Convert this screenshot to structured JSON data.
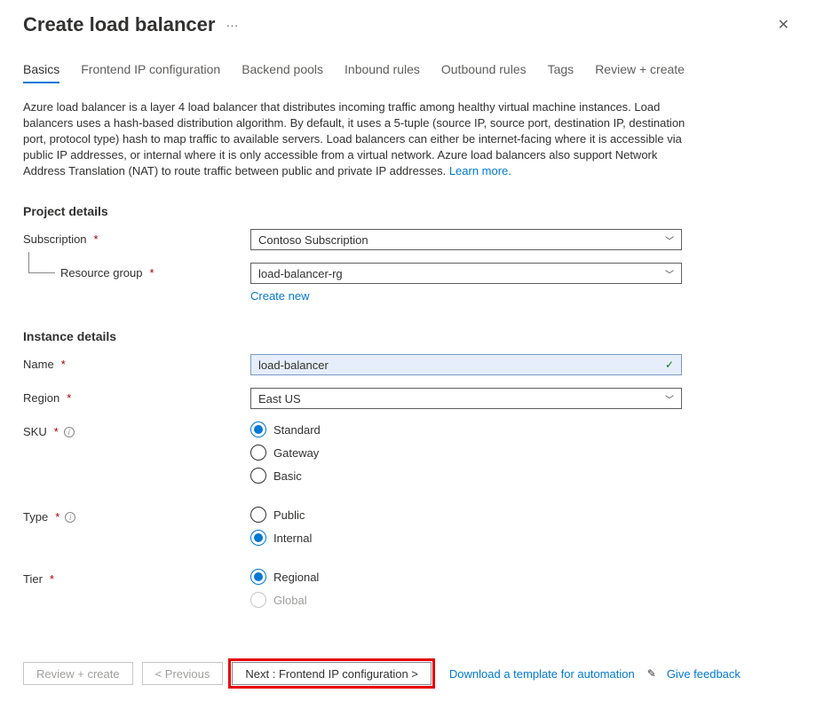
{
  "header": {
    "title": "Create load balancer",
    "ellipsis": "···"
  },
  "tabs": [
    {
      "key": "basics",
      "label": "Basics",
      "active": true
    },
    {
      "key": "frontend",
      "label": "Frontend IP configuration",
      "active": false
    },
    {
      "key": "backend",
      "label": "Backend pools",
      "active": false
    },
    {
      "key": "inbound",
      "label": "Inbound rules",
      "active": false
    },
    {
      "key": "outbound",
      "label": "Outbound rules",
      "active": false
    },
    {
      "key": "tags",
      "label": "Tags",
      "active": false
    },
    {
      "key": "review",
      "label": "Review + create",
      "active": false
    }
  ],
  "description": {
    "text": "Azure load balancer is a layer 4 load balancer that distributes incoming traffic among healthy virtual machine instances. Load balancers uses a hash-based distribution algorithm. By default, it uses a 5-tuple (source IP, source port, destination IP, destination port, protocol type) hash to map traffic to available servers. Load balancers can either be internet-facing where it is accessible via public IP addresses, or internal where it is only accessible from a virtual network. Azure load balancers also support Network Address Translation (NAT) to route traffic between public and private IP addresses. ",
    "learn_more": "Learn more."
  },
  "sections": {
    "project": {
      "title": "Project details",
      "subscription": {
        "label": "Subscription",
        "value": "Contoso Subscription"
      },
      "resource_group": {
        "label": "Resource group",
        "value": "load-balancer-rg",
        "create_new": "Create new"
      }
    },
    "instance": {
      "title": "Instance details",
      "name": {
        "label": "Name",
        "value": "load-balancer"
      },
      "region": {
        "label": "Region",
        "value": "East US"
      },
      "sku": {
        "label": "SKU",
        "options": [
          {
            "value": "Standard",
            "selected": true
          },
          {
            "value": "Gateway",
            "selected": false
          },
          {
            "value": "Basic",
            "selected": false
          }
        ]
      },
      "type": {
        "label": "Type",
        "options": [
          {
            "value": "Public",
            "selected": false
          },
          {
            "value": "Internal",
            "selected": true
          }
        ]
      },
      "tier": {
        "label": "Tier",
        "options": [
          {
            "value": "Regional",
            "selected": true,
            "disabled": false
          },
          {
            "value": "Global",
            "selected": false,
            "disabled": true
          }
        ]
      }
    }
  },
  "footer": {
    "review": "Review + create",
    "previous": "< Previous",
    "next": "Next : Frontend IP configuration >",
    "download": "Download a template for automation",
    "feedback": "Give feedback"
  }
}
